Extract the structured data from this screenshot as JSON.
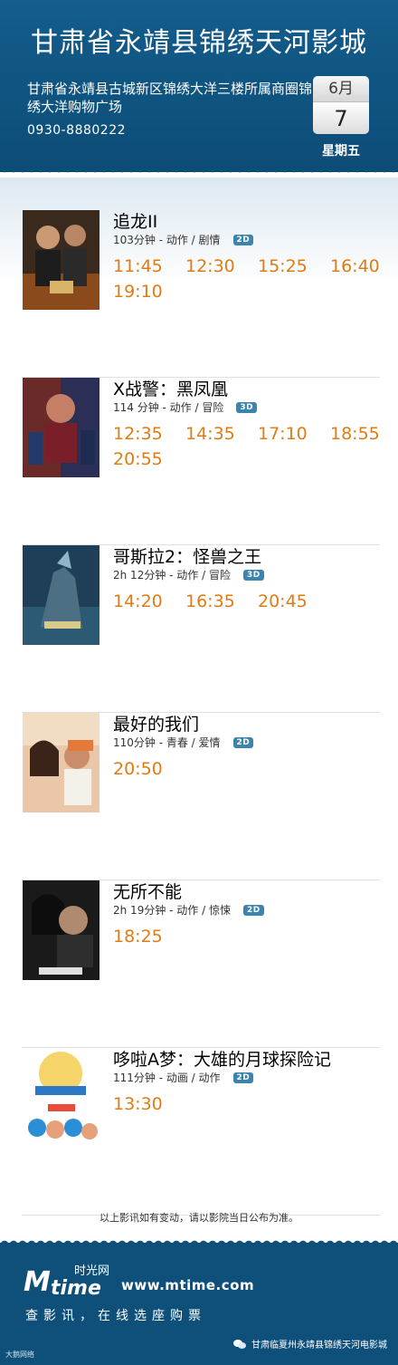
{
  "header": {
    "cinema_title": "甘肃省永靖县锦绣天河影城",
    "address": "甘肃省永靖县古城新区锦绣大洋三楼所属商圈锦绣大洋购物广场",
    "phone": "0930-8880222",
    "month": "6月",
    "day": "7",
    "weekday": "星期五"
  },
  "movies": [
    {
      "title": "追龙II",
      "meta": "103分钟 - 动作 / 剧情",
      "format": "2D",
      "times": [
        "11:45",
        "12:30",
        "15:25",
        "16:40",
        "19:10"
      ]
    },
    {
      "title": "X战警：黑凤凰",
      "meta": "114 分钟 - 动作 / 冒险",
      "format": "3D",
      "times": [
        "12:35",
        "14:35",
        "17:10",
        "18:55",
        "20:55"
      ]
    },
    {
      "title": "哥斯拉2：怪兽之王",
      "meta": "2h 12分钟 - 动作 / 冒险",
      "format": "3D",
      "times": [
        "14:20",
        "16:35",
        "20:45"
      ]
    },
    {
      "title": "最好的我们",
      "meta": "110分钟 - 青春 / 爱情",
      "format": "2D",
      "times": [
        "20:50"
      ]
    },
    {
      "title": "无所不能",
      "meta": "2h 19分钟 - 动作 / 惊悚",
      "format": "2D",
      "times": [
        "18:25"
      ]
    },
    {
      "title": "哆啦A梦：大雄的月球探险记",
      "meta": "111分钟 - 动画 / 动作",
      "format": "2D",
      "times": [
        "13:30"
      ]
    }
  ],
  "notice": "以上影讯如有变动，请以影院当日公布为准。",
  "footer": {
    "logo_cn": "时光网",
    "logo_m": "M",
    "logo_time": "time",
    "site": "www.mtime.com",
    "tagline": "查影讯，在线选座购票",
    "watermark": "大鹅网络",
    "wechat_account": "甘肃临夏州永靖县锦绣天河电影城"
  },
  "colors": {
    "header_blue": "#0f537f",
    "time_orange": "#e07c12",
    "badge_blue": "#3c83ad"
  },
  "icons": {
    "wechat": "wechat-icon"
  }
}
